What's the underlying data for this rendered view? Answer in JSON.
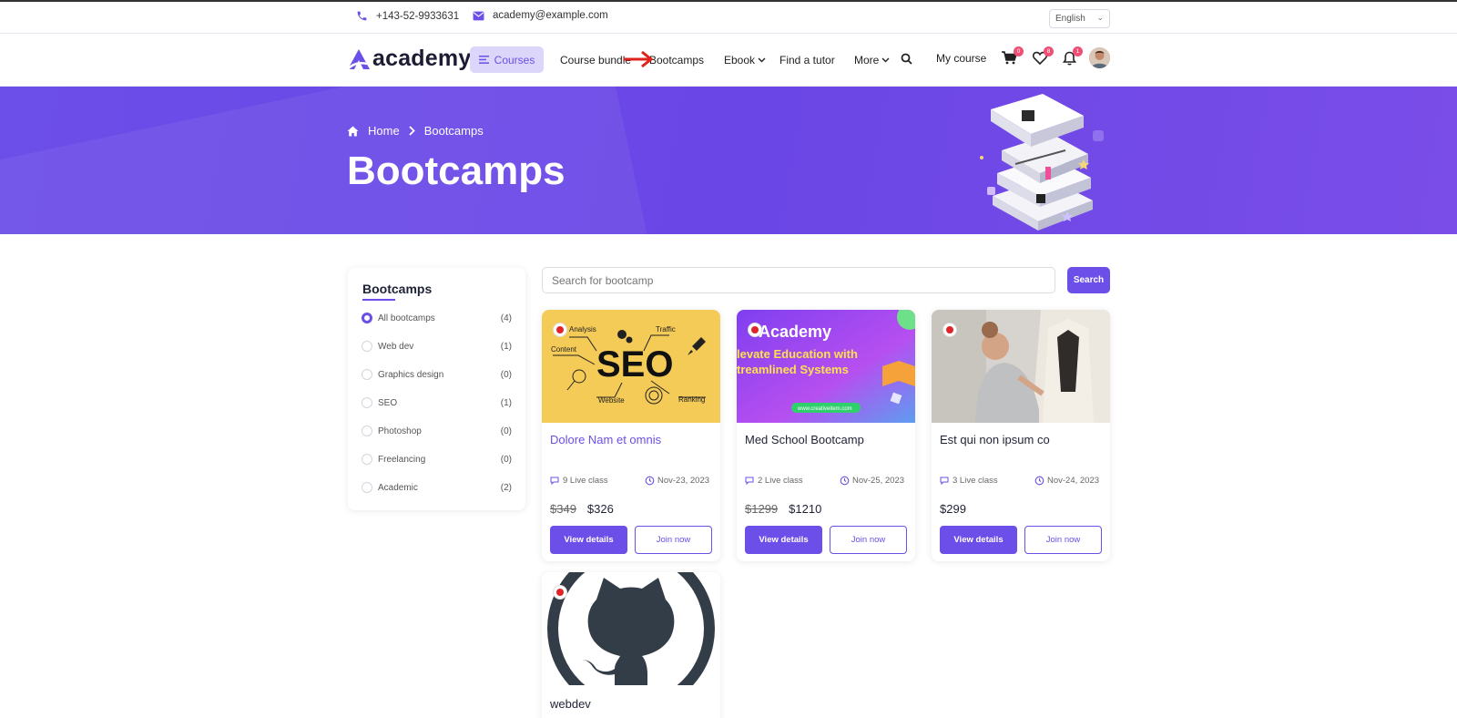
{
  "topbar": {
    "phone": "+143-52-9933631",
    "email": "academy@example.com",
    "language": "English"
  },
  "nav": {
    "logo_text": "academy",
    "courses": "Courses",
    "links": [
      "Course bundle",
      "Bootcamps",
      "Ebook",
      "Find a tutor",
      "More"
    ],
    "my_course": "My course",
    "cart_count": "0",
    "wishlist_count": "8",
    "notification_count": "1"
  },
  "hero": {
    "breadcrumb_home": "Home",
    "breadcrumb_current": "Bootcamps",
    "title": "Bootcamps"
  },
  "sidebar": {
    "title": "Bootcamps",
    "filters": [
      {
        "label": "All bootcamps",
        "count": "(4)",
        "selected": true
      },
      {
        "label": "Web dev",
        "count": "(1)",
        "selected": false
      },
      {
        "label": "Graphics design",
        "count": "(0)",
        "selected": false
      },
      {
        "label": "SEO",
        "count": "(1)",
        "selected": false
      },
      {
        "label": "Photoshop",
        "count": "(0)",
        "selected": false
      },
      {
        "label": "Freelancing",
        "count": "(0)",
        "selected": false
      },
      {
        "label": "Academic",
        "count": "(2)",
        "selected": false
      }
    ]
  },
  "search": {
    "placeholder": "Search for bootcamp",
    "button": "Search"
  },
  "cards": [
    {
      "title": "Dolore Nam et omnis",
      "live": "9 Live class",
      "date": "Nov-23, 2023",
      "old_price": "$349",
      "price": "$326",
      "view": "View details",
      "join": "Join now",
      "thumb": {
        "seo": "SEO",
        "analysis": "Analysis",
        "traffic": "Traffic",
        "content": "Content",
        "website": "Website",
        "ranking": "Ranking"
      }
    },
    {
      "title": "Med School Bootcamp",
      "live": "2 Live class",
      "date": "Nov-25, 2023",
      "old_price": "$1299",
      "price": "$1210",
      "view": "View details",
      "join": "Join now",
      "thumb": {
        "brand": "Academy",
        "line1": "levate Education with",
        "line2": "treamlined Systems",
        "url": "www.creativeitem.com"
      }
    },
    {
      "title": "Est qui non ipsum co",
      "live": "3 Live class",
      "date": "Nov-24, 2023",
      "old_price": "",
      "price": "$299",
      "view": "View details",
      "join": "Join now"
    },
    {
      "title": "webdev"
    }
  ],
  "colors": {
    "accent": "#6c4ee8",
    "badge": "#ef4f74",
    "seo_bg": "#f5cb57"
  }
}
